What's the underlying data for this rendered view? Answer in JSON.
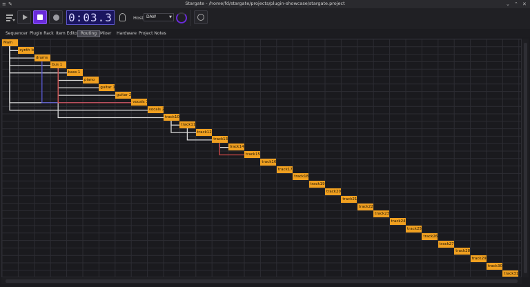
{
  "window": {
    "title": "Stargate - /home/fd/stargate/projects/plugin-showcase/stargate.project",
    "min_glyph": "⌄",
    "max_glyph": "⌃",
    "close_glyph": "✕"
  },
  "toolbar": {
    "clock": "0:03.3",
    "host_label": "Host:",
    "host_value": "DAW",
    "host_caret": "▼"
  },
  "tabs": [
    {
      "label": "Sequencer",
      "active": false
    },
    {
      "label": "Plugin Rack",
      "active": false
    },
    {
      "label": "Item Editor",
      "active": false
    },
    {
      "label": "Routing",
      "active": true
    },
    {
      "label": "Mixer",
      "active": false
    },
    {
      "label": "Hardware",
      "active": false
    },
    {
      "label": "Project Notes",
      "active": false
    }
  ],
  "routing": {
    "nodes": [
      "Main",
      "synth lead",
      "drums",
      "bus 1",
      "bass 1",
      "piano",
      "guitar 1",
      "guitar 2",
      "vocals 1",
      "vocals 2",
      "track10",
      "track11",
      "track12",
      "track13",
      "track14",
      "track15",
      "track16",
      "track17",
      "track18",
      "track19",
      "track20",
      "track21",
      "track22",
      "track23",
      "track24",
      "track25",
      "track26",
      "track27",
      "track28",
      "track29",
      "track30",
      "track31"
    ],
    "node_color": "#f0a020",
    "connections": [
      {
        "from": 1,
        "to": 0,
        "color": "#d8d8d8"
      },
      {
        "from": 2,
        "to": 0,
        "color": "#d8d8d8"
      },
      {
        "from": 3,
        "to": 0,
        "color": "#d8d8d8"
      },
      {
        "from": 4,
        "to": 0,
        "color": "#d8d8d8"
      },
      {
        "from": 8,
        "to": 0,
        "color": "#d8d8d8"
      },
      {
        "from": 9,
        "to": 0,
        "color": "#d8d8d8"
      },
      {
        "from": 5,
        "to": 3,
        "color": "#d8d8d8"
      },
      {
        "from": 6,
        "to": 3,
        "color": "#d8d8d8"
      },
      {
        "from": 7,
        "to": 3,
        "color": "#d8d8d8"
      },
      {
        "from": 10,
        "to": 3,
        "color": "#d8d8d8"
      },
      {
        "from": 8,
        "to": 2,
        "color": "#5a5ad8"
      },
      {
        "from": 8,
        "to": 3,
        "color": "#d04848"
      },
      {
        "from": 11,
        "to": 10,
        "color": "#d8d8d8"
      },
      {
        "from": 12,
        "to": 10,
        "color": "#d8d8d8"
      },
      {
        "from": 13,
        "to": 11,
        "color": "#d8d8d8"
      },
      {
        "from": 14,
        "to": 13,
        "color": "#d8d8d8"
      },
      {
        "from": 15,
        "to": 13,
        "color": "#d04848"
      }
    ]
  }
}
